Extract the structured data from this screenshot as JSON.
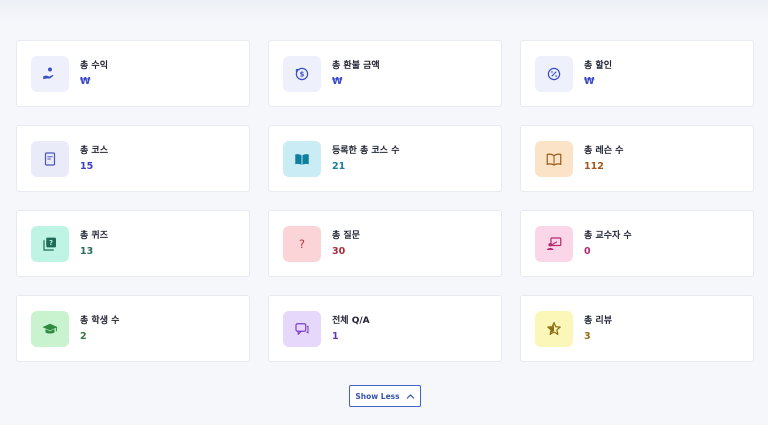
{
  "stats": [
    {
      "label": "총 수익",
      "value": "₩",
      "icon": "hand-coin-icon",
      "bg": "#eef0fb",
      "fg": "#3b4fc4",
      "valueColor": "#3b49c6"
    },
    {
      "label": "총 환불 금액",
      "value": "₩",
      "icon": "refund-icon",
      "bg": "#eef0fb",
      "fg": "#3b4fc4",
      "valueColor": "#3b49c6"
    },
    {
      "label": "총 할인",
      "value": "₩",
      "icon": "discount-icon",
      "bg": "#eef0fb",
      "fg": "#3b4fc4",
      "valueColor": "#3b49c6"
    },
    {
      "label": "총 코스",
      "value": "15",
      "icon": "book-icon",
      "bg": "#e9ecf8",
      "fg": "#4a56b8",
      "valueColor": "#3b3fc4"
    },
    {
      "label": "등록한 총 코스 수",
      "value": "21",
      "icon": "open-book-icon",
      "bg": "#c9ecf5",
      "fg": "#0f7fa0",
      "valueColor": "#1b7d98"
    },
    {
      "label": "총 레슨 수",
      "value": "112",
      "icon": "lessons-book-icon",
      "bg": "#fbe3c8",
      "fg": "#9a5a18",
      "valueColor": "#a3581a"
    },
    {
      "label": "총 퀴즈",
      "value": "13",
      "icon": "quiz-icon",
      "bg": "#bff3e3",
      "fg": "#1f6b58",
      "valueColor": "#2a6d5a"
    },
    {
      "label": "총 질문",
      "value": "30",
      "icon": "question-icon",
      "bg": "#fbd4d8",
      "fg": "#c0303f",
      "valueColor": "#b12a3a"
    },
    {
      "label": "총 교수자 수",
      "value": "0",
      "icon": "instructor-icon",
      "bg": "#fbd6e8",
      "fg": "#b52a6c",
      "valueColor": "#b52a6c"
    },
    {
      "label": "총 학생 수",
      "value": "2",
      "icon": "graduation-cap-icon",
      "bg": "#c9f3cf",
      "fg": "#2d8a3e",
      "valueColor": "#2f7a3a"
    },
    {
      "label": "전체 Q/A",
      "value": "1",
      "icon": "chat-icon",
      "bg": "#e6d8fb",
      "fg": "#7a3fc8",
      "valueColor": "#6b34b8"
    },
    {
      "label": "총 리뷰",
      "value": "3",
      "icon": "star-icon",
      "bg": "#fbf7b9",
      "fg": "#8a6b10",
      "valueColor": "#9a6a12"
    }
  ],
  "show_less_label": "Show Less",
  "show_less_icon": "chevron-up-icon"
}
